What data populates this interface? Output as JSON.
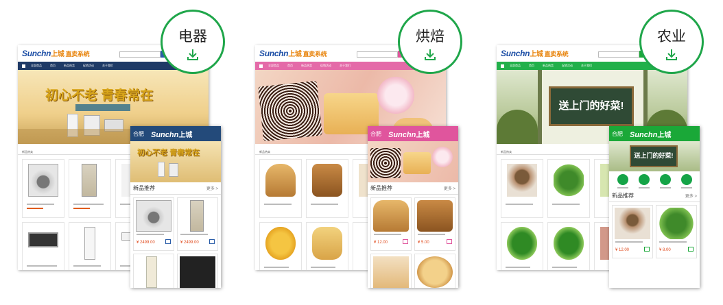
{
  "panels": [
    {
      "category": "电器",
      "theme": "#1e3a66",
      "nav_color": "#1e3a66",
      "mobile_header_color": "#234a7a",
      "logo_latin": "Sunchn",
      "logo_cn": "上城",
      "logo_system": "直卖系统",
      "mobile_city": "合肥",
      "mobile_section_title": "新品推荐",
      "mobile_more": "更多",
      "products": [
        {
          "price": "¥ 2499.00"
        },
        {
          "price": "¥ 2499.00"
        }
      ],
      "banner_text": "初心不老 青春常在"
    },
    {
      "category": "烘焙",
      "theme": "#e0559d",
      "nav_color": "#e46aa8",
      "mobile_header_color": "#e0559d",
      "logo_latin": "Sunchn",
      "logo_cn": "上城",
      "logo_system": "直卖系统",
      "mobile_city": "合肥",
      "mobile_section_title": "新品推荐",
      "mobile_more": "更多",
      "products": [
        {
          "price": "¥ 12.00"
        },
        {
          "price": "¥ 5.00"
        }
      ],
      "banner_text": ""
    },
    {
      "category": "农业",
      "theme": "#1aa838",
      "nav_color": "#21b04a",
      "mobile_header_color": "#1aa838",
      "logo_latin": "Sunchn",
      "logo_cn": "上城",
      "logo_system": "直卖系统",
      "mobile_city": "合肥",
      "mobile_section_title": "新品推荐",
      "mobile_more": "更多",
      "products": [
        {
          "price": "¥ 12.00"
        },
        {
          "price": "¥ 8.00"
        }
      ],
      "banner_text": "送上门的好菜!"
    }
  ],
  "icons": {
    "badge_arrow": "download-arrow-icon",
    "cart": "cart-icon"
  }
}
